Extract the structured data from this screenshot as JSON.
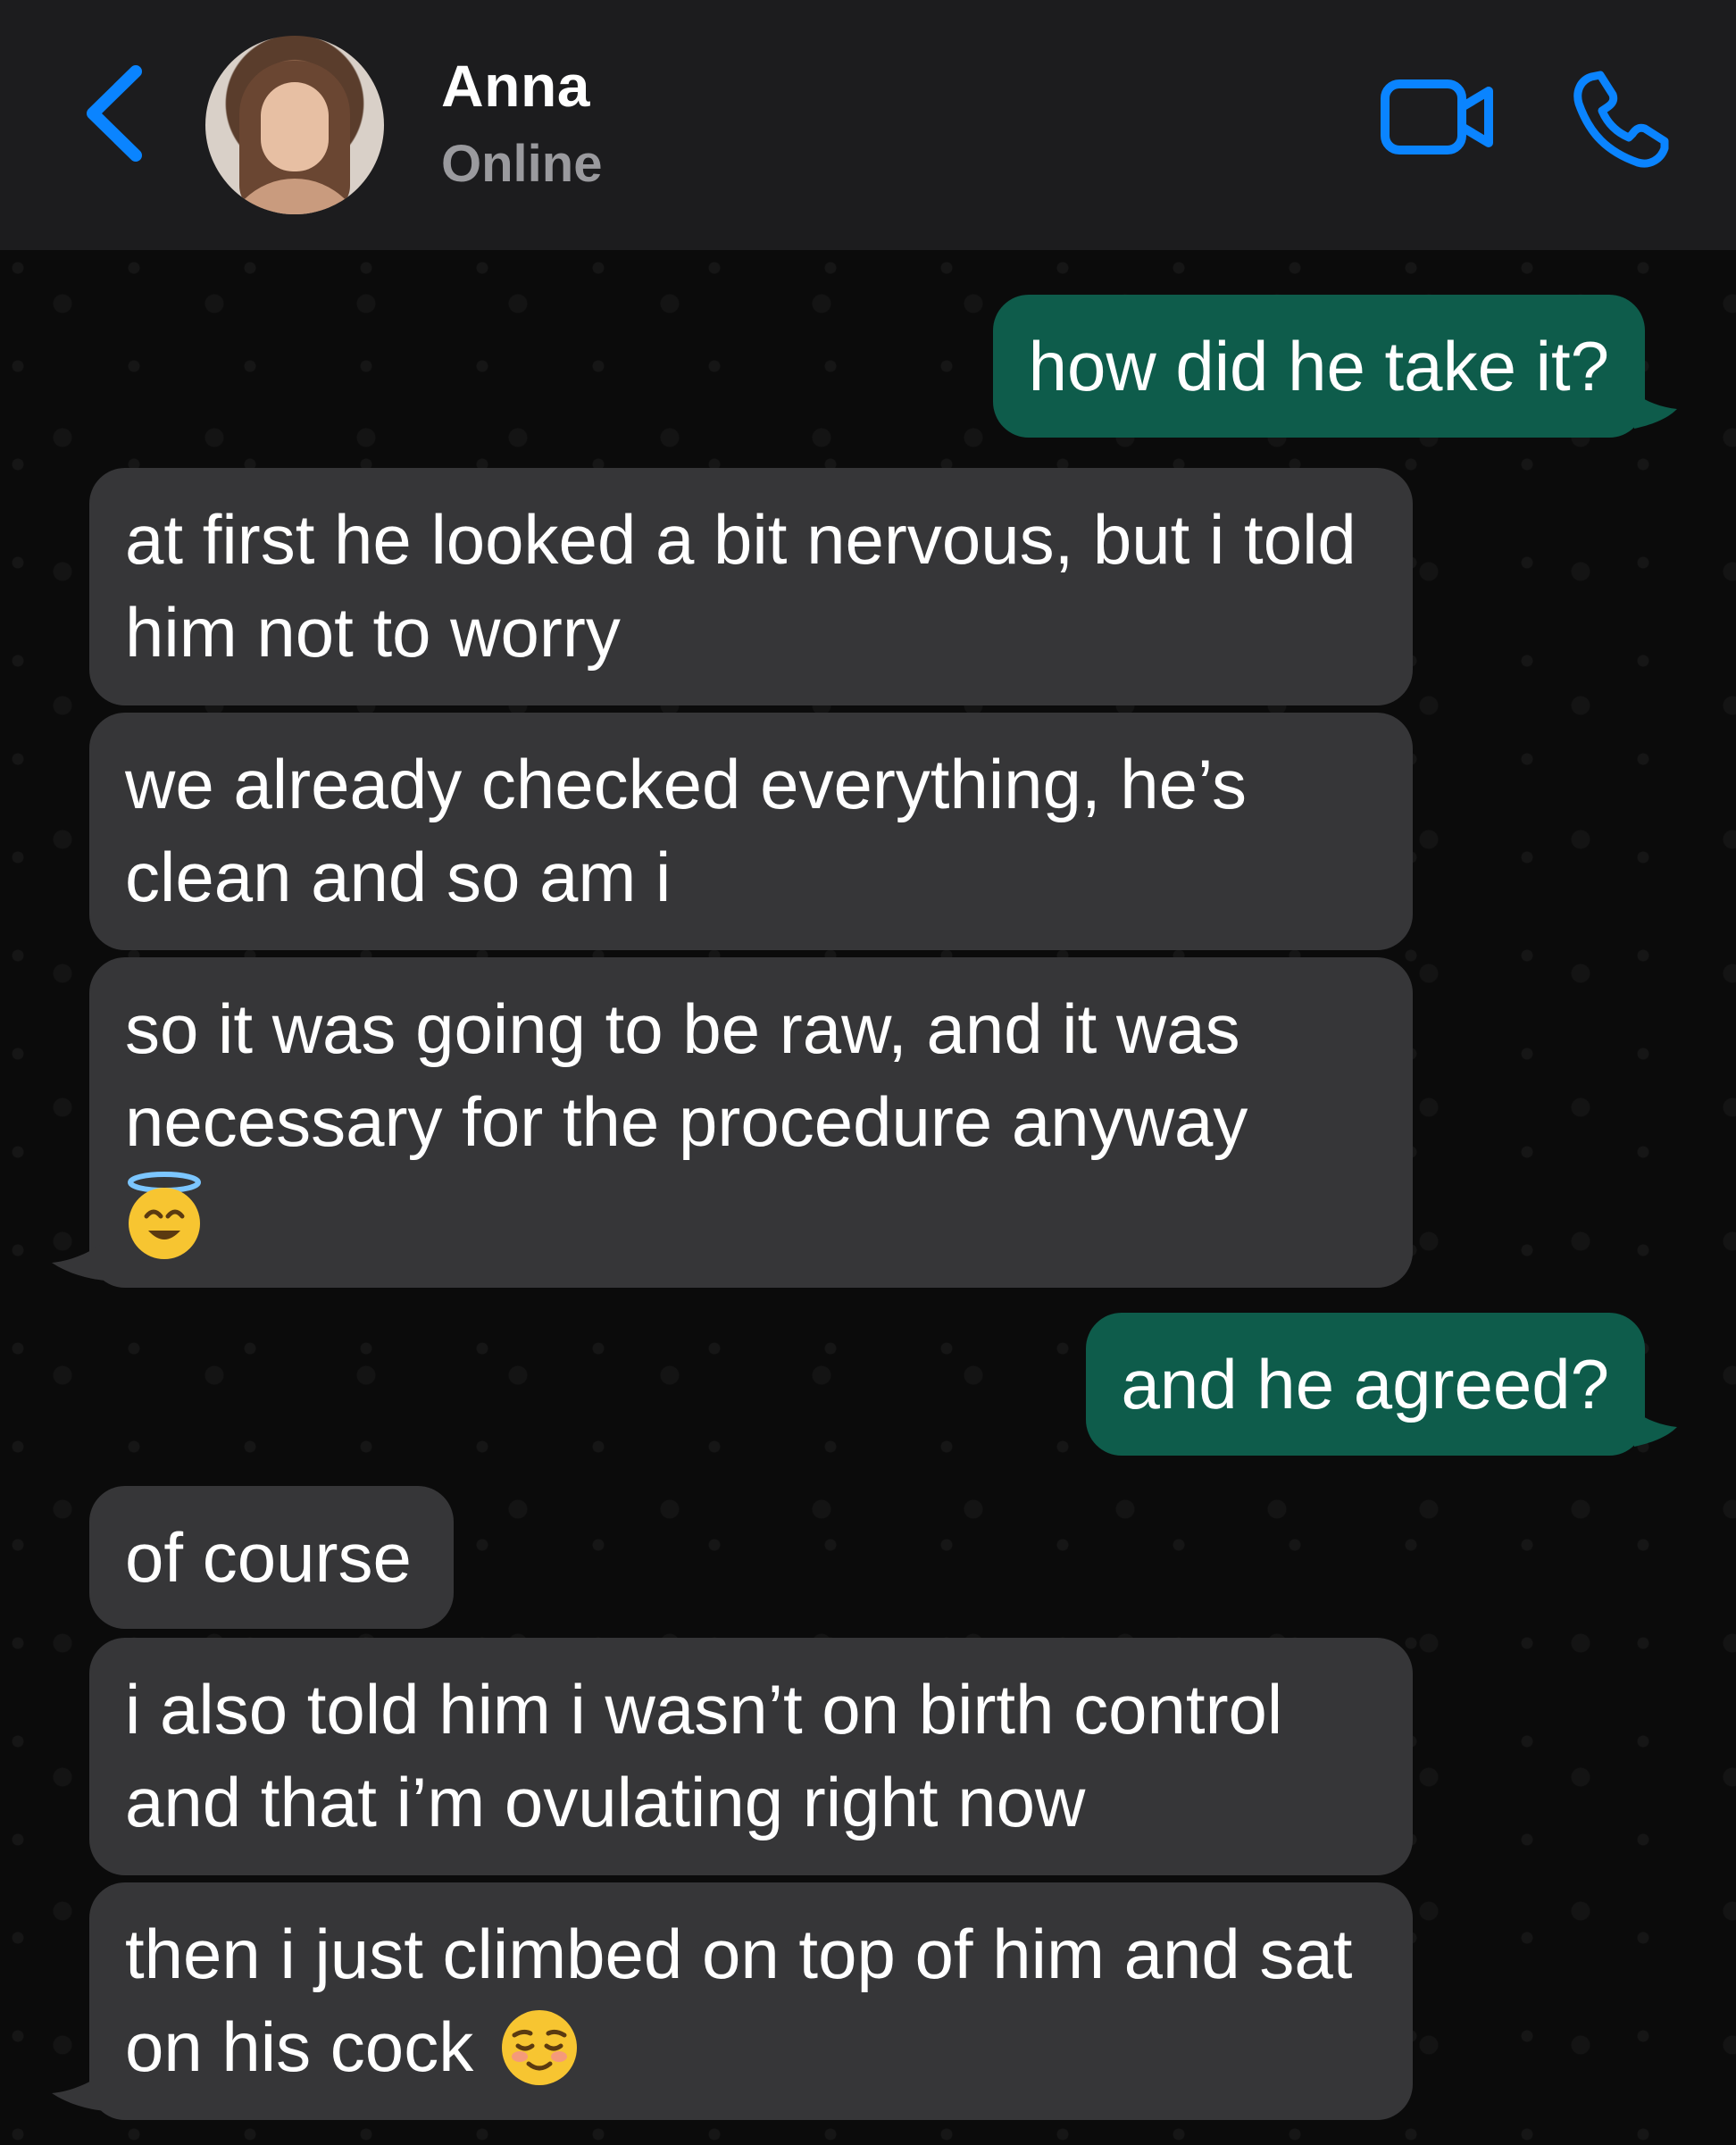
{
  "header": {
    "contact_name": "Anna",
    "contact_status": "Online",
    "back_icon": "chevron-left-icon",
    "video_icon": "video-camera-icon",
    "phone_icon": "phone-icon",
    "accent_color": "#0a84ff"
  },
  "messages": [
    {
      "direction": "outgoing",
      "text": "how did he take it?"
    },
    {
      "direction": "incoming",
      "text": "at first he looked a bit nervous, but i told him not to worry"
    },
    {
      "direction": "incoming",
      "text": "we already checked everything, he’s clean and so am i"
    },
    {
      "direction": "incoming",
      "text": "so it was going to be raw, and it was necessary for the procedure anyway",
      "emoji": "smiling-face-with-halo"
    },
    {
      "direction": "outgoing",
      "text": "and he agreed?"
    },
    {
      "direction": "incoming",
      "text": "of course"
    },
    {
      "direction": "incoming",
      "text": "i also told him i wasn’t on birth control and that i’m ovulating right now"
    },
    {
      "direction": "incoming",
      "text": "then i just climbed on top of him and sat on his cock",
      "emoji": "relieved-face"
    }
  ],
  "colors": {
    "incoming_bubble": "#363638",
    "outgoing_bubble": "#0e5c4b",
    "header_bg": "#1c1c1e"
  }
}
